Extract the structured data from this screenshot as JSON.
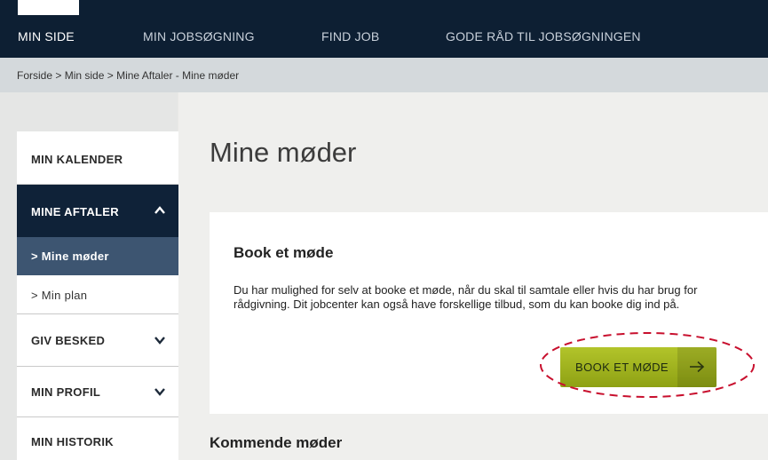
{
  "topnav": {
    "items": [
      {
        "label": "MIN SIDE",
        "active": true
      },
      {
        "label": "MIN JOBSØGNING",
        "active": false
      },
      {
        "label": "FIND JOB",
        "active": false
      },
      {
        "label": "GODE RÅD TIL JOBSØGNINGEN",
        "active": false
      }
    ]
  },
  "breadcrumb": {
    "items": [
      "Forside",
      "Min side",
      "Mine Aftaler - Mine møder"
    ],
    "separator": ">"
  },
  "sidebar": {
    "items": [
      {
        "label": "MIN KALENDER"
      },
      {
        "label": "MINE AFTALER",
        "icon": "chevron-up-icon",
        "state": "expanded"
      },
      {
        "label": "> Mine møder",
        "state": "selected"
      },
      {
        "label": "> Min plan"
      },
      {
        "label": "GIV BESKED",
        "icon": "chevron-down-icon"
      },
      {
        "label": "MIN PROFIL",
        "icon": "chevron-down-icon"
      },
      {
        "label": "MIN HISTORIK"
      }
    ]
  },
  "main": {
    "title": "Mine møder",
    "card": {
      "title": "Book et møde",
      "text": "Du har mulighed for selv at booke et møde, når du skal til samtale eller hvis du har brug for rådgivning. Dit jobcenter kan også have forskellige tilbud, som du kan booke dig ind på.",
      "button_label": "BOOK ET MØDE",
      "button_icon": "arrow-right-icon"
    },
    "upcoming_title": "Kommende møder"
  },
  "colors": {
    "topbar": "#0d1f33",
    "sidebar_dark": "#0f2238",
    "sidebar_selected": "#3d5571",
    "button_green": "#a3b61f",
    "highlight_ellipse": "#c8102e"
  }
}
